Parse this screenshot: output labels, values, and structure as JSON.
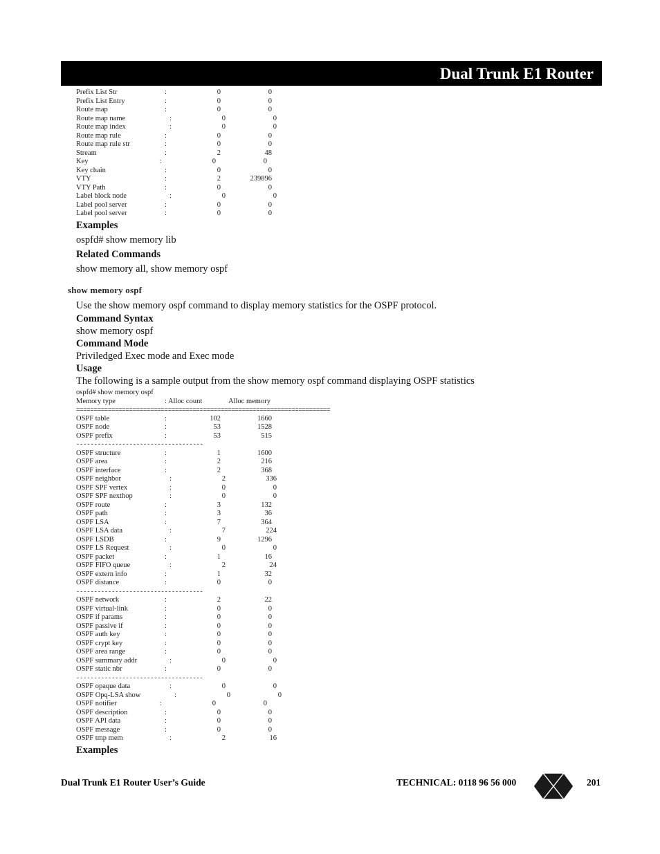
{
  "header": {
    "title": "Dual Trunk E1 Router"
  },
  "lib_stats": {
    "rows": [
      {
        "label": "Prefix List Str",
        "count": "0",
        "memory": "0",
        "indent": 0
      },
      {
        "label": "Prefix List Entry",
        "count": "0",
        "memory": "0",
        "indent": 0
      },
      {
        "label": "Route map",
        "count": "0",
        "memory": "0",
        "indent": 0
      },
      {
        "label": "Route map name",
        "count": "0",
        "memory": "0",
        "indent": 1
      },
      {
        "label": "Route map index",
        "count": "0",
        "memory": "0",
        "indent": 1
      },
      {
        "label": "Route map rule",
        "count": "0",
        "memory": "0",
        "indent": 0
      },
      {
        "label": "Route map rule str",
        "count": "0",
        "memory": "0",
        "indent": 0
      },
      {
        "label": "Stream",
        "count": "2",
        "memory": "48",
        "indent": 0
      },
      {
        "label": "Key",
        "count": "0",
        "memory": "0",
        "indent": -1
      },
      {
        "label": "Key chain",
        "count": "0",
        "memory": "0",
        "indent": 0
      },
      {
        "label": "VTY",
        "count": "2",
        "memory": "239896",
        "indent": 0
      },
      {
        "label": "VTY Path",
        "count": "0",
        "memory": "0",
        "indent": 0
      },
      {
        "label": "Label block node",
        "count": "0",
        "memory": "0",
        "indent": 1
      },
      {
        "label": "Label pool server",
        "count": "0",
        "memory": "0",
        "indent": 0
      },
      {
        "label": "Label pool server",
        "count": "0",
        "memory": "0",
        "indent": 0
      }
    ]
  },
  "lib_section": {
    "examples_heading": "Examples",
    "example_command": "ospfd# show memory lib",
    "related_heading": "Related Commands",
    "related_commands": "show memory all, show memory ospf"
  },
  "ospf_section": {
    "heading": "show memory ospf",
    "description": "Use the show memory ospf command to display memory statistics for the OSPF protocol.",
    "syntax_heading": "Command Syntax",
    "syntax": "show memory ospf",
    "mode_heading": "Command Mode",
    "mode": "Priviledged Exec mode and Exec mode",
    "usage_heading": "Usage",
    "usage": "The following is a sample output from the show memory ospf command displaying OSPF statistics",
    "examples_heading": "Examples"
  },
  "ospf_output": {
    "prompt_line": "ospfd# show memory ospf",
    "col_label": "Memory type",
    "col_count": ": Alloc count",
    "col_memory": "Alloc memory",
    "groups": [
      {
        "rows": [
          {
            "label": "OSPF table",
            "count": "102",
            "memory": "1660",
            "indent": 0
          },
          {
            "label": "OSPF node",
            "count": "53",
            "memory": "1528",
            "indent": 0
          },
          {
            "label": "OSPF prefix",
            "count": "53",
            "memory": "515",
            "indent": 0
          }
        ]
      },
      {
        "rows": [
          {
            "label": "OSPF structure",
            "count": "1",
            "memory": "1600",
            "indent": 0
          },
          {
            "label": "OSPF area",
            "count": "2",
            "memory": "216",
            "indent": 0
          },
          {
            "label": "OSPF interface",
            "count": "2",
            "memory": "368",
            "indent": 0
          },
          {
            "label": "OSPF neighbor",
            "count": "2",
            "memory": "336",
            "indent": 1
          },
          {
            "label": "OSPF SPF vertex",
            "count": "0",
            "memory": "0",
            "indent": 1
          },
          {
            "label": "OSPF SPF nexthop",
            "count": "0",
            "memory": "0",
            "indent": 1
          },
          {
            "label": "OSPF route",
            "count": "3",
            "memory": "132",
            "indent": 0
          },
          {
            "label": "OSPF path",
            "count": "3",
            "memory": "36",
            "indent": 0
          },
          {
            "label": "OSPF LSA",
            "count": "7",
            "memory": "364",
            "indent": 0
          },
          {
            "label": "OSPF LSA data",
            "count": "7",
            "memory": "224",
            "indent": 1
          },
          {
            "label": "OSPF LSDB",
            "count": "9",
            "memory": "1296",
            "indent": 0
          },
          {
            "label": "OSPF LS Request",
            "count": "0",
            "memory": "0",
            "indent": 1
          },
          {
            "label": "OSPF packet",
            "count": "1",
            "memory": "16",
            "indent": 0
          },
          {
            "label": "OSPF FIFO queue",
            "count": "2",
            "memory": "24",
            "indent": 1
          },
          {
            "label": "OSPF extern info",
            "count": "1",
            "memory": "32",
            "indent": 0
          },
          {
            "label": "OSPF distance",
            "count": "0",
            "memory": "0",
            "indent": 0
          }
        ]
      },
      {
        "rows": [
          {
            "label": "OSPF network",
            "count": "2",
            "memory": "22",
            "indent": 0
          },
          {
            "label": "OSPF virtual-link",
            "count": "0",
            "memory": "0",
            "indent": 0
          },
          {
            "label": "OSPF if params",
            "count": "0",
            "memory": "0",
            "indent": 0
          },
          {
            "label": "OSPF passive if",
            "count": "0",
            "memory": "0",
            "indent": 0
          },
          {
            "label": "OSPF auth key",
            "count": "0",
            "memory": "0",
            "indent": 0
          },
          {
            "label": "OSPF crypt key",
            "count": "0",
            "memory": "0",
            "indent": 0
          },
          {
            "label": "OSPF area range",
            "count": "0",
            "memory": "0",
            "indent": 0
          },
          {
            "label": "OSPF summary addr",
            "count": "0",
            "memory": "0",
            "indent": 1
          },
          {
            "label": "OSPF static nbr",
            "count": "0",
            "memory": "0",
            "indent": 0
          }
        ]
      },
      {
        "rows": [
          {
            "label": "OSPF opaque data",
            "count": "0",
            "memory": "0",
            "indent": 1
          },
          {
            "label": "OSPF Opq-LSA show",
            "count": "0",
            "memory": "0",
            "indent": 2
          },
          {
            "label": "OSPF notifier",
            "count": "0",
            "memory": "0",
            "indent": -1
          },
          {
            "label": "OSPF description",
            "count": "0",
            "memory": "0",
            "indent": 0
          },
          {
            "label": "OSPF API data",
            "count": "0",
            "memory": "0",
            "indent": 0
          },
          {
            "label": "OSPF message",
            "count": "0",
            "memory": "0",
            "indent": 0
          },
          {
            "label": "OSPF tmp mem",
            "count": "2",
            "memory": "16",
            "indent": 1
          }
        ]
      }
    ]
  },
  "footer": {
    "guide": "Dual Trunk E1 Router User’s Guide",
    "technical": "TECHNICAL:  0118 96 56 000",
    "page_number": "201"
  },
  "colors": {
    "banner_background": "#000000",
    "banner_text": "#ffffff",
    "body_text": "#000000",
    "section_heading": "#2b2b2b"
  }
}
